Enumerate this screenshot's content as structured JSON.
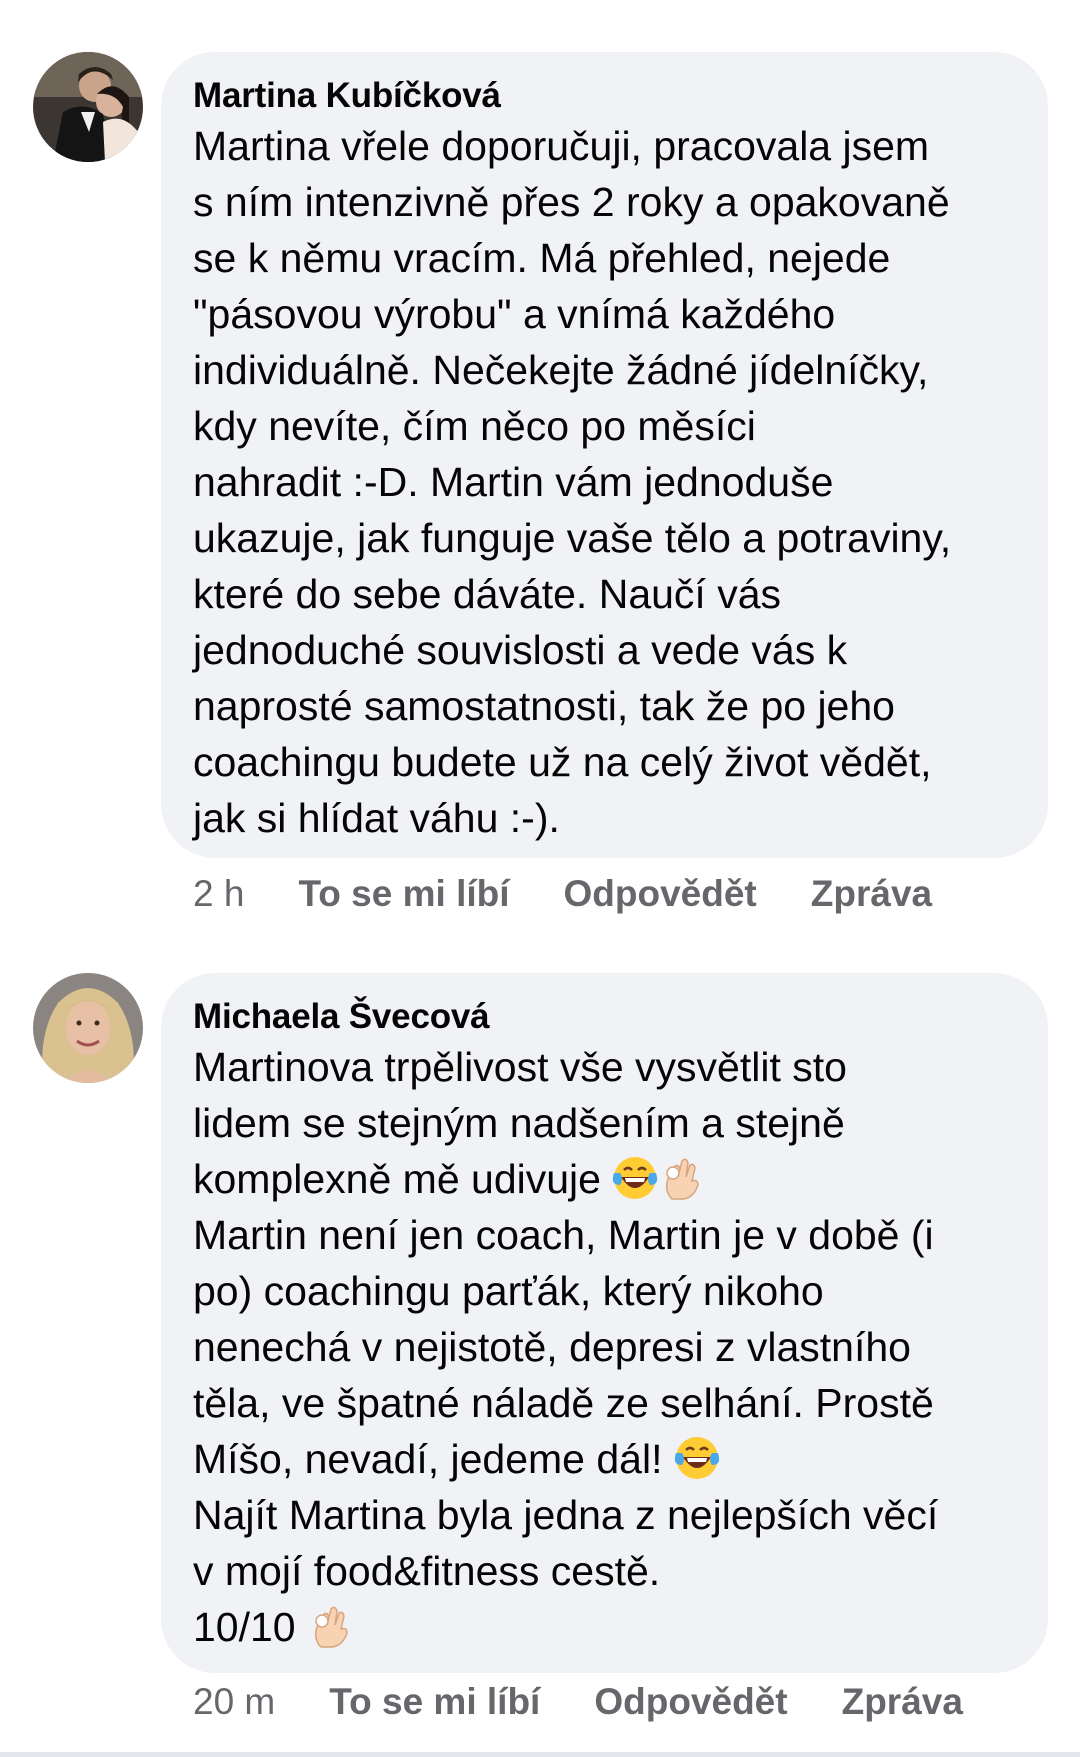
{
  "comments": [
    {
      "author": "Martina Kubíčková",
      "lines": [
        "Martina vřele doporučuji, pracovala jsem",
        "s ním intenzivně přes 2 roky a opakovaně",
        "se k němu vracím. Má přehled, nejede",
        "\"pásovou výrobu\" a vnímá každého",
        "individuálně. Nečekejte žádné jídelníčky,",
        "kdy nevíte, čím něco po měsíci",
        "nahradit :-D. Martin vám jednoduše",
        "ukazuje, jak funguje vaše tělo a potraviny,",
        "které do sebe dáváte. Naučí vás",
        "jednoduché souvislosti a vede vás k",
        "naprosté samostatnosti, tak že po jeho",
        "coachingu budete už na celý život vědět,",
        "jak si hlídat váhu :-)."
      ],
      "time": "2 h",
      "like": "To se mi líbí",
      "reply": "Odpovědět",
      "message": "Zpráva"
    },
    {
      "author": "Michaela Švecová",
      "lines": [
        "Martinova trpělivost vše vysvětlit sto",
        "lidem se stejným nadšením a stejně",
        "komplexně mě udivuje ",
        "Martin není jen coach, Martin je v době (i",
        "po) coachingu parťák, který nikoho",
        "nenechá v nejistotě, depresi z vlastního",
        "těla, ve špatné náladě ze selhání. Prostě",
        "Míšo, nevadí, jedeme dál! ",
        "Najít Martina byla jedna z nejlepších věcí",
        "v mojí food&fitness cestě.",
        "10/10 "
      ],
      "time": "20 m",
      "like": "To se mi líbí",
      "reply": "Odpovědět",
      "message": "Zpráva"
    }
  ],
  "icons": {
    "laugh": "face-with-tears-of-joy-emoji",
    "ok": "ok-hand-emoji"
  },
  "colors": {
    "bubble": "#f0f2f5",
    "meta": "#65676b",
    "text": "#050505"
  }
}
